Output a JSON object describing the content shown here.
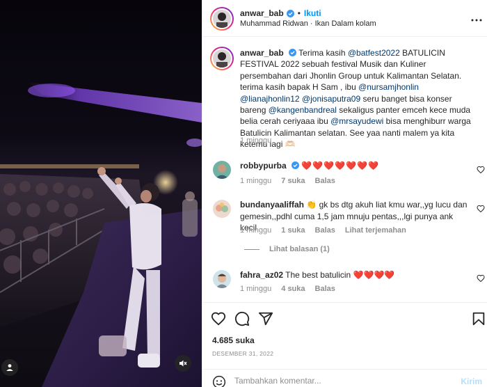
{
  "post": {
    "author": "anwar_bab",
    "follow_label": "Ikuti",
    "separator": "•",
    "audio": "Muhammad Ridwan · Ikan Dalam kolam",
    "caption_username": "anwar_bab",
    "caption_parts": [
      {
        "text": "Terima kasih ",
        "mention": false
      },
      {
        "text": "@batfest2022",
        "mention": true
      },
      {
        "text": " BATULICIN FESTIVAL 2022 sebuah festival Musik dan Kuliner persembahan dari Jhonlin Group untuk Kalimantan Selatan. terima kasih bapak H Sam , ibu ",
        "mention": false
      },
      {
        "text": "@nursamjhonlin",
        "mention": true
      },
      {
        "text": " ",
        "mention": false
      },
      {
        "text": "@lianajhonlin12",
        "mention": true
      },
      {
        "text": " ",
        "mention": false
      },
      {
        "text": "@jonisaputra09",
        "mention": true
      },
      {
        "text": " seru banget bisa konser bareng ",
        "mention": false
      },
      {
        "text": "@kangenbandreal",
        "mention": true
      },
      {
        "text": " sekaligus panter emceh kece muda belia cerah ceriyaaa ibu ",
        "mention": false
      },
      {
        "text": "@mrsayudewi",
        "mention": true
      },
      {
        "text": " bisa menghiburr warga Batulicin Kalimantan selatan. See yaa nanti malem ya kita ketemu lagi 🫶🏻",
        "mention": false
      }
    ],
    "caption_time": "1 minggu",
    "likes": "4.685 suka",
    "date": "DESEMBER 31, 2022",
    "comment_placeholder": "Tambahkan komentar...",
    "send_label": "Kirim"
  },
  "comments": [
    {
      "username": "robbypurba",
      "verified": true,
      "text": "❤️❤️❤️❤️❤️❤️❤️",
      "time": "1 minggu",
      "likes": "7 suka",
      "reply_label": "Balas",
      "translate_label": ""
    },
    {
      "username": "bundanyaaliffah",
      "verified": false,
      "text": "👏 gk bs dtg akuh liat kmu war,,yg lucu dan gemesin,,pdhl cuma 1,5 jam mnuju pentas,,,lgi punya ank kecil",
      "time": "1 minggu",
      "likes": "1 suka",
      "reply_label": "Balas",
      "translate_label": "Lihat terjemahan"
    },
    {
      "username": "fahra_az02",
      "verified": false,
      "text": "The best batulicin ❤️❤️❤️❤️",
      "time": "1 minggu",
      "likes": "4 suka",
      "reply_label": "Balas",
      "translate_label": ""
    }
  ],
  "replies_label": "Lihat balasan (1)",
  "icons": {
    "more": "more-options-icon",
    "like": "heart-icon",
    "comment": "comment-icon",
    "share": "send-icon",
    "save": "bookmark-icon",
    "emoji": "emoji-icon",
    "tag": "user-tag-icon",
    "mute": "muted-speaker-icon"
  },
  "colors": {
    "link": "#0095f6",
    "mention": "#00376b",
    "heart": "#ed4956",
    "secondary_text": "#8e8e8e"
  }
}
